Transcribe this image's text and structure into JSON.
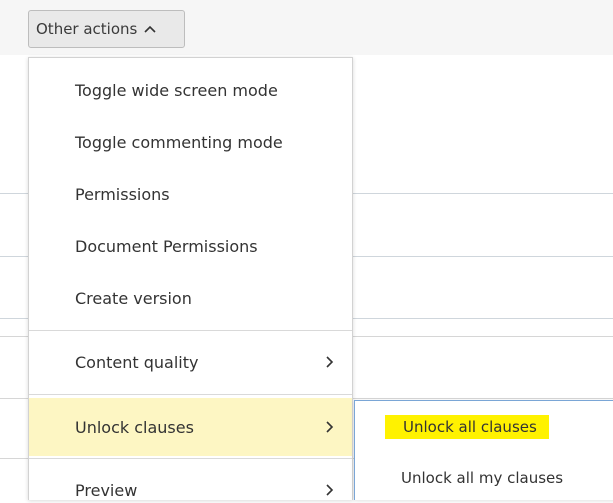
{
  "toolbar": {
    "other_actions_label": "Other actions",
    "chevron_icon": "chevron-up-icon"
  },
  "menu": {
    "items": [
      {
        "label": "Toggle wide screen mode",
        "has_submenu": false
      },
      {
        "label": "Toggle commenting mode",
        "has_submenu": false
      },
      {
        "label": "Permissions",
        "has_submenu": false
      },
      {
        "label": "Document Permissions",
        "has_submenu": false
      },
      {
        "label": "Create version",
        "has_submenu": false
      },
      {
        "label": "Content quality",
        "has_submenu": true
      },
      {
        "label": "Unlock clauses",
        "has_submenu": true,
        "active": true
      },
      {
        "label": "Preview",
        "has_submenu": true
      }
    ]
  },
  "submenu": {
    "items": [
      {
        "label": "Unlock all clauses",
        "highlighted": true
      },
      {
        "label": "Unlock all my clauses",
        "highlighted": false
      }
    ]
  },
  "colors": {
    "active_item_bg": "#fdf6c3",
    "highlight": "#fff200",
    "submenu_border": "#7aa6d6"
  }
}
